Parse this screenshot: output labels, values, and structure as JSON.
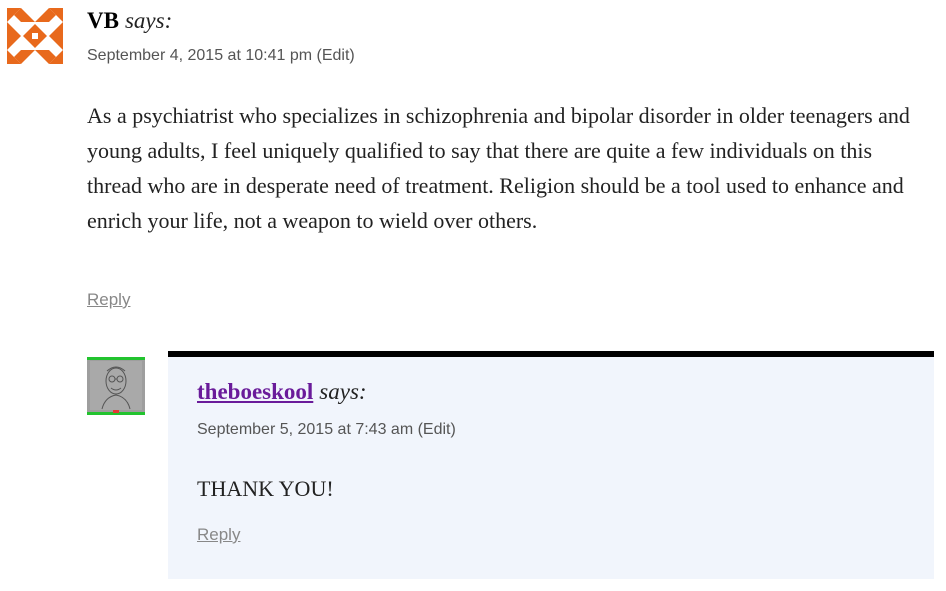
{
  "comments": [
    {
      "author": "VB",
      "says": "says:",
      "date": "September 4, 2015 at 10:41 pm",
      "edit": "(Edit)",
      "text": "As a psychiatrist who specializes in schizophrenia and bipolar disorder in older teenagers and young adults, I feel uniquely qualified to say that there are quite a few individuals on this thread who are in desperate need of treatment. Religion should be a tool used to enhance and enrich your life, not a weapon to wield over others.",
      "reply": "Reply",
      "avatar_icon": "orange-identicon",
      "avatar_color": "#e8691c"
    },
    {
      "author": "theboeskool",
      "says": "says:",
      "date": "September 5, 2015 at 7:43 am",
      "edit": "(Edit)",
      "text": "THANK YOU!",
      "reply": "Reply",
      "avatar_icon": "sketch-portrait-avatar",
      "author_link_color": "#6a1b9a",
      "reply_bg": "#f1f5fc"
    }
  ]
}
